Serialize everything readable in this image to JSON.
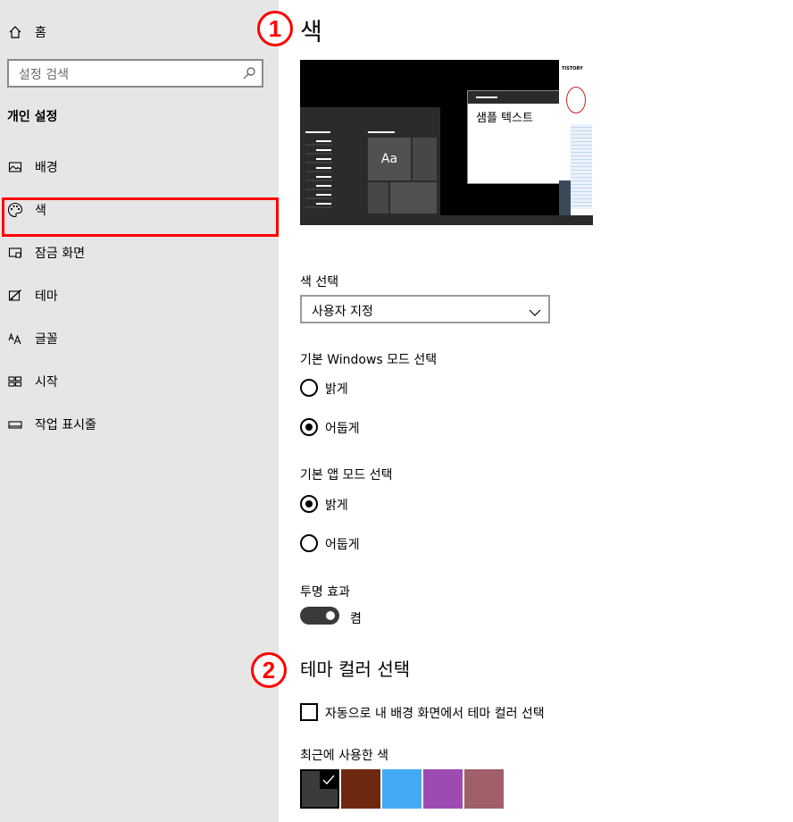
{
  "sidebar": {
    "home_label": "홈",
    "search_placeholder": "설정 검색",
    "section_title": "개인 설정",
    "items": [
      {
        "label": "배경",
        "icon": "picture-icon"
      },
      {
        "label": "색",
        "icon": "palette-icon"
      },
      {
        "label": "잠금 화면",
        "icon": "lock-screen-icon"
      },
      {
        "label": "테마",
        "icon": "theme-icon"
      },
      {
        "label": "글꼴",
        "icon": "font-icon"
      },
      {
        "label": "시작",
        "icon": "start-icon"
      },
      {
        "label": "작업 표시줄",
        "icon": "taskbar-icon"
      }
    ],
    "selected": "색"
  },
  "annotations": {
    "badge1": "1",
    "badge2": "2",
    "color": "#ff0000"
  },
  "main": {
    "title": "색",
    "preview": {
      "tile_text": "Aa",
      "sample_text": "샘플 텍스트",
      "logo_text": "TISTORY"
    },
    "color_select": {
      "label": "색 선택",
      "value": "사용자 지정"
    },
    "windows_mode": {
      "label": "기본 Windows 모드 선택",
      "options": [
        "밝게",
        "어둡게"
      ],
      "selected": "어둡게"
    },
    "app_mode": {
      "label": "기본 앱 모드 선택",
      "options": [
        "밝게",
        "어둡게"
      ],
      "selected": "밝게"
    },
    "transparency": {
      "label": "투명 효과",
      "state": "켬",
      "on": true
    },
    "accent": {
      "title": "테마 컬러 선택",
      "auto_label": "자동으로 내 배경 화면에서 테마 컬러 선택",
      "auto_checked": false,
      "recent_label": "최근에 사용한 색",
      "recent_colors": [
        "#3b3b3b",
        "#6e2810",
        "#44aaf6",
        "#9d4bb3",
        "#a15f6a"
      ],
      "selected_index": 0
    }
  },
  "colors": {
    "sidebar_bg": "#e6e6e6",
    "content_bg": "#ffffff",
    "toggle_on": "#3a3a3a"
  }
}
